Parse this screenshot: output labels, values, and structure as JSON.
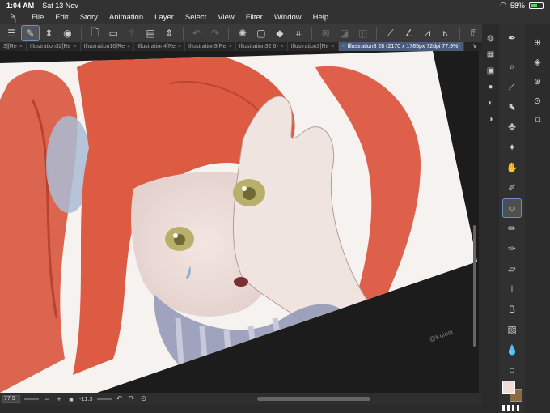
{
  "status_bar": {
    "time": "1:04 AM",
    "date": "Sat 13 Nov",
    "battery": "58%",
    "battery_level": 0.58
  },
  "menu": {
    "items": [
      "File",
      "Edit",
      "Story",
      "Animation",
      "Layer",
      "Select",
      "View",
      "Filter",
      "Window",
      "Help"
    ]
  },
  "tabs": {
    "items": [
      {
        "label": "3][Re"
      },
      {
        "label": "Illustration32[Re"
      },
      {
        "label": "Illustration16[Re"
      },
      {
        "label": "Illustration4[Re"
      },
      {
        "label": "Illustration9[Re"
      },
      {
        "label": "Illustration32 6)"
      },
      {
        "label": "Illustration3[Re"
      },
      {
        "label": "Illustration3 28 (2170 x 1785px 72dpi 77.9%)",
        "active": true
      }
    ]
  },
  "canvas": {
    "signature": "@Kuiest"
  },
  "bottom_bar": {
    "zoom": "77.9",
    "rotation": "-11.3"
  },
  "colors": {
    "main": "#f0ddd3",
    "sub": "#8a6a3e",
    "accent": "#6a8fd1"
  }
}
